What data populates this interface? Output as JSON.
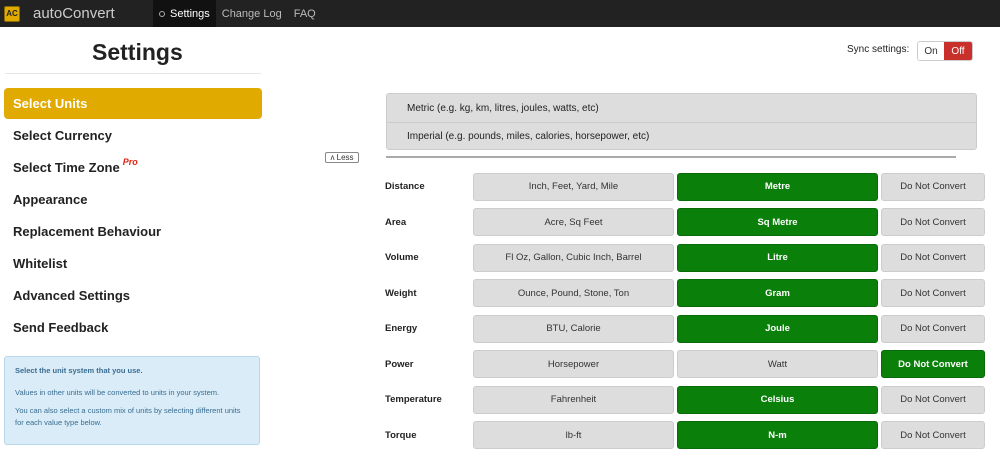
{
  "app": {
    "name": "autoConvert",
    "logo_text": "AC"
  },
  "nav": [
    {
      "label": "Settings",
      "active": true
    },
    {
      "label": "Change Log",
      "active": false
    },
    {
      "label": "FAQ",
      "active": false
    }
  ],
  "page_title": "Settings",
  "sidebar": {
    "items": [
      {
        "label": "Select Units",
        "active": true
      },
      {
        "label": "Select Currency",
        "active": false
      },
      {
        "label": "Select Time Zone",
        "badge": "Pro",
        "active": false
      },
      {
        "label": "Appearance",
        "active": false
      },
      {
        "label": "Replacement Behaviour",
        "active": false
      },
      {
        "label": "Whitelist",
        "active": false
      },
      {
        "label": "Advanced Settings",
        "active": false
      },
      {
        "label": "Send Feedback",
        "active": false
      }
    ]
  },
  "info": {
    "heading": "Select the unit system that you use.",
    "line1": "Values in other units will be converted to units in your system.",
    "line2": "You can also select a custom mix of units by selecting different units for each value type below."
  },
  "sync": {
    "label": "Sync settings:",
    "on": "On",
    "off": "Off",
    "selected": "Off"
  },
  "less_button": "ʌ Less",
  "systems": [
    "Metric (e.g. kg, km, litres, joules, watts, etc)",
    "Imperial (e.g. pounds, miles, calories, horsepower, etc)"
  ],
  "units": [
    {
      "label": "Distance",
      "options": [
        "Inch, Feet, Yard, Mile",
        "Metre",
        "Do Not Convert"
      ],
      "selected": 1
    },
    {
      "label": "Area",
      "options": [
        "Acre, Sq Feet",
        "Sq Metre",
        "Do Not Convert"
      ],
      "selected": 1
    },
    {
      "label": "Volume",
      "options": [
        "Fl Oz, Gallon, Cubic Inch, Barrel",
        "Litre",
        "Do Not Convert"
      ],
      "selected": 1
    },
    {
      "label": "Weight",
      "options": [
        "Ounce, Pound, Stone, Ton",
        "Gram",
        "Do Not Convert"
      ],
      "selected": 1
    },
    {
      "label": "Energy",
      "options": [
        "BTU, Calorie",
        "Joule",
        "Do Not Convert"
      ],
      "selected": 1
    },
    {
      "label": "Power",
      "options": [
        "Horsepower",
        "Watt",
        "Do Not Convert"
      ],
      "selected": 2
    },
    {
      "label": "Temperature",
      "options": [
        "Fahrenheit",
        "Celsius",
        "Do Not Convert"
      ],
      "selected": 1
    },
    {
      "label": "Torque",
      "options": [
        "lb-ft",
        "N-m",
        "Do Not Convert"
      ],
      "selected": 1
    }
  ],
  "colors": {
    "accent": "#e0aa00",
    "selected": "#0a7f0a",
    "off_active": "#c9302c",
    "info_bg": "#d9ecf7"
  }
}
